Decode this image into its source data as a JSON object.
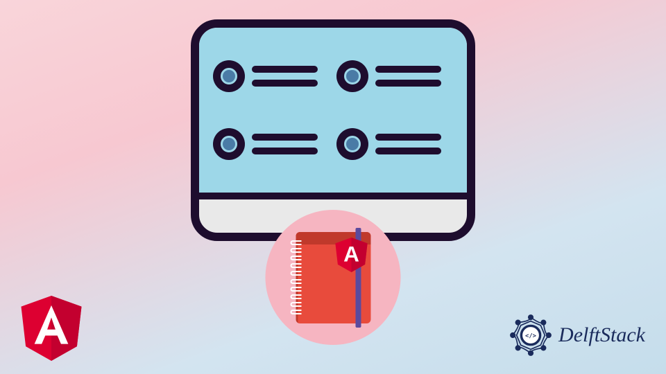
{
  "brand": {
    "name": "DelftStack"
  },
  "icons": {
    "angular_letter": "A",
    "delftstack_glyph": "</>"
  },
  "colors": {
    "angular_red": "#dd0031",
    "angular_dark": "#c3002f",
    "delft_blue": "#1a2b5c"
  }
}
